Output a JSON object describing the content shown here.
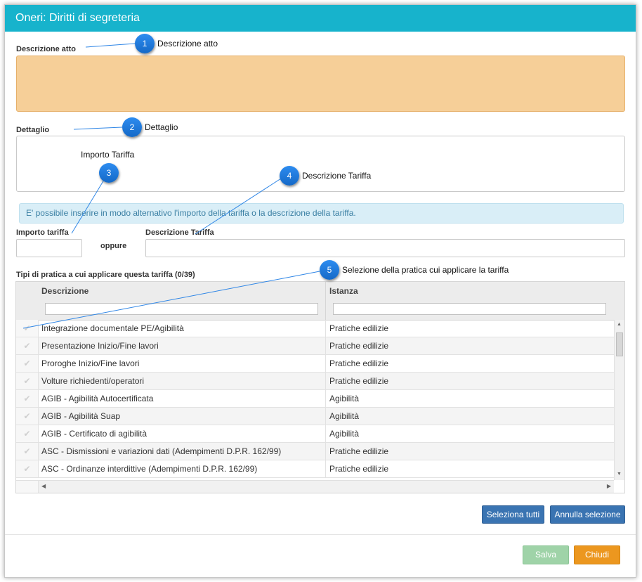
{
  "dialog": {
    "title": "Oneri: Diritti di segreteria"
  },
  "form": {
    "descrizione_atto_label": "Descrizione atto",
    "dettaglio_label": "Dettaglio",
    "info_message": "E' possibile inserire in modo alternativo l'importo della tariffa o la descrizione della tariffa.",
    "importo_tariffa_label": "Importo tariffa",
    "oppure_label": "oppure",
    "descrizione_tariffa_label": "Descrizione Tariffa",
    "tipi_pratica_label": "Tipi di pratica a cui applicare questa tariffa (0/39)"
  },
  "grid": {
    "columns": [
      "Descrizione",
      "Istanza"
    ],
    "rows": [
      {
        "descrizione": "Integrazione documentale PE/Agibilità",
        "istanza": "Pratiche edilizie"
      },
      {
        "descrizione": "Presentazione Inizio/Fine lavori",
        "istanza": "Pratiche edilizie"
      },
      {
        "descrizione": "Proroghe Inizio/Fine lavori",
        "istanza": "Pratiche edilizie"
      },
      {
        "descrizione": "Volture richiedenti/operatori",
        "istanza": "Pratiche edilizie"
      },
      {
        "descrizione": "AGIB - Agibilità Autocertificata",
        "istanza": "Agibilità"
      },
      {
        "descrizione": "AGIB - Agibilità Suap",
        "istanza": "Agibilità"
      },
      {
        "descrizione": "AGIB - Certificato di agibilità",
        "istanza": "Agibilità"
      },
      {
        "descrizione": "ASC - Dismissioni e variazioni dati (Adempimenti D.P.R. 162/99)",
        "istanza": "Pratiche edilizie"
      },
      {
        "descrizione": "ASC - Ordinanze interdittive (Adempimenti D.P.R. 162/99)",
        "istanza": "Pratiche edilizie"
      }
    ]
  },
  "buttons": {
    "seleziona_tutti": "Seleziona tutti",
    "annulla_selezione": "Annulla selezione",
    "salva": "Salva",
    "chiudi": "Chiudi"
  },
  "callouts": [
    {
      "number": "1",
      "text": "Descrizione atto"
    },
    {
      "number": "2",
      "text": "Dettaglio"
    },
    {
      "number": "3",
      "text": "Importo Tariffa"
    },
    {
      "number": "4",
      "text": "Descrizione Tariffa"
    },
    {
      "number": "5",
      "text": "Selezione della pratica cui applicare la tariffa"
    }
  ],
  "icons": {
    "row_check": "check-icon",
    "scroll_up": "arrow-up-icon",
    "scroll_down": "arrow-down-icon",
    "scroll_left": "arrow-left-icon",
    "scroll_right": "arrow-right-icon"
  },
  "colors": {
    "titlebar": "#17b3cc",
    "orange_field": "#f6cf98",
    "info_bg": "#d9eef7",
    "blue_button": "#3a74b2",
    "save_button": "#9fd3a8",
    "close_button": "#ec971f",
    "callout": "#1e7be0"
  }
}
